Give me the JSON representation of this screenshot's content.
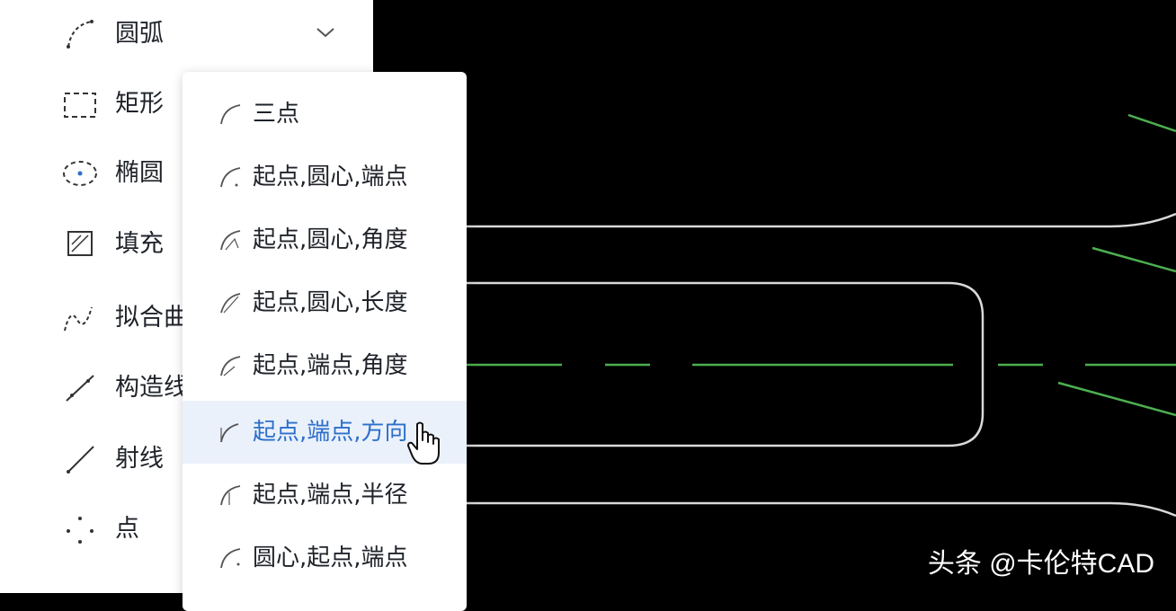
{
  "sidebar": {
    "items": [
      {
        "label": "圆弧",
        "icon": "arc-icon"
      },
      {
        "label": "矩形",
        "icon": "rectangle-icon"
      },
      {
        "label": "椭圆",
        "icon": "ellipse-icon"
      },
      {
        "label": "填充",
        "icon": "hatch-icon"
      },
      {
        "label": "拟合曲",
        "icon": "spline-icon"
      },
      {
        "label": "构造线",
        "icon": "construction-line-icon"
      },
      {
        "label": "射线",
        "icon": "ray-icon"
      },
      {
        "label": "点",
        "icon": "point-icon"
      }
    ]
  },
  "arc_menu": {
    "items": [
      {
        "label": "三点",
        "icon": "arc-3point-icon"
      },
      {
        "label": "起点,圆心,端点",
        "icon": "arc-start-center-end-icon"
      },
      {
        "label": "起点,圆心,角度",
        "icon": "arc-start-center-angle-icon"
      },
      {
        "label": "起点,圆心,长度",
        "icon": "arc-start-center-length-icon"
      },
      {
        "label": "起点,端点,角度",
        "icon": "arc-start-end-angle-icon"
      },
      {
        "label": "起点,端点,方向",
        "icon": "arc-start-end-direction-icon",
        "active": true
      },
      {
        "label": "起点,端点,半径",
        "icon": "arc-start-end-radius-icon"
      },
      {
        "label": "圆心,起点,端点",
        "icon": "arc-center-start-end-icon"
      }
    ]
  },
  "watermark": "头条 @卡伦特CAD",
  "colors": {
    "canvas_bg": "#000000",
    "line_white": "#d9d9d9",
    "line_green": "#4caf50",
    "active_bg": "#eaf1fb",
    "active_text": "#2d6fc9"
  }
}
